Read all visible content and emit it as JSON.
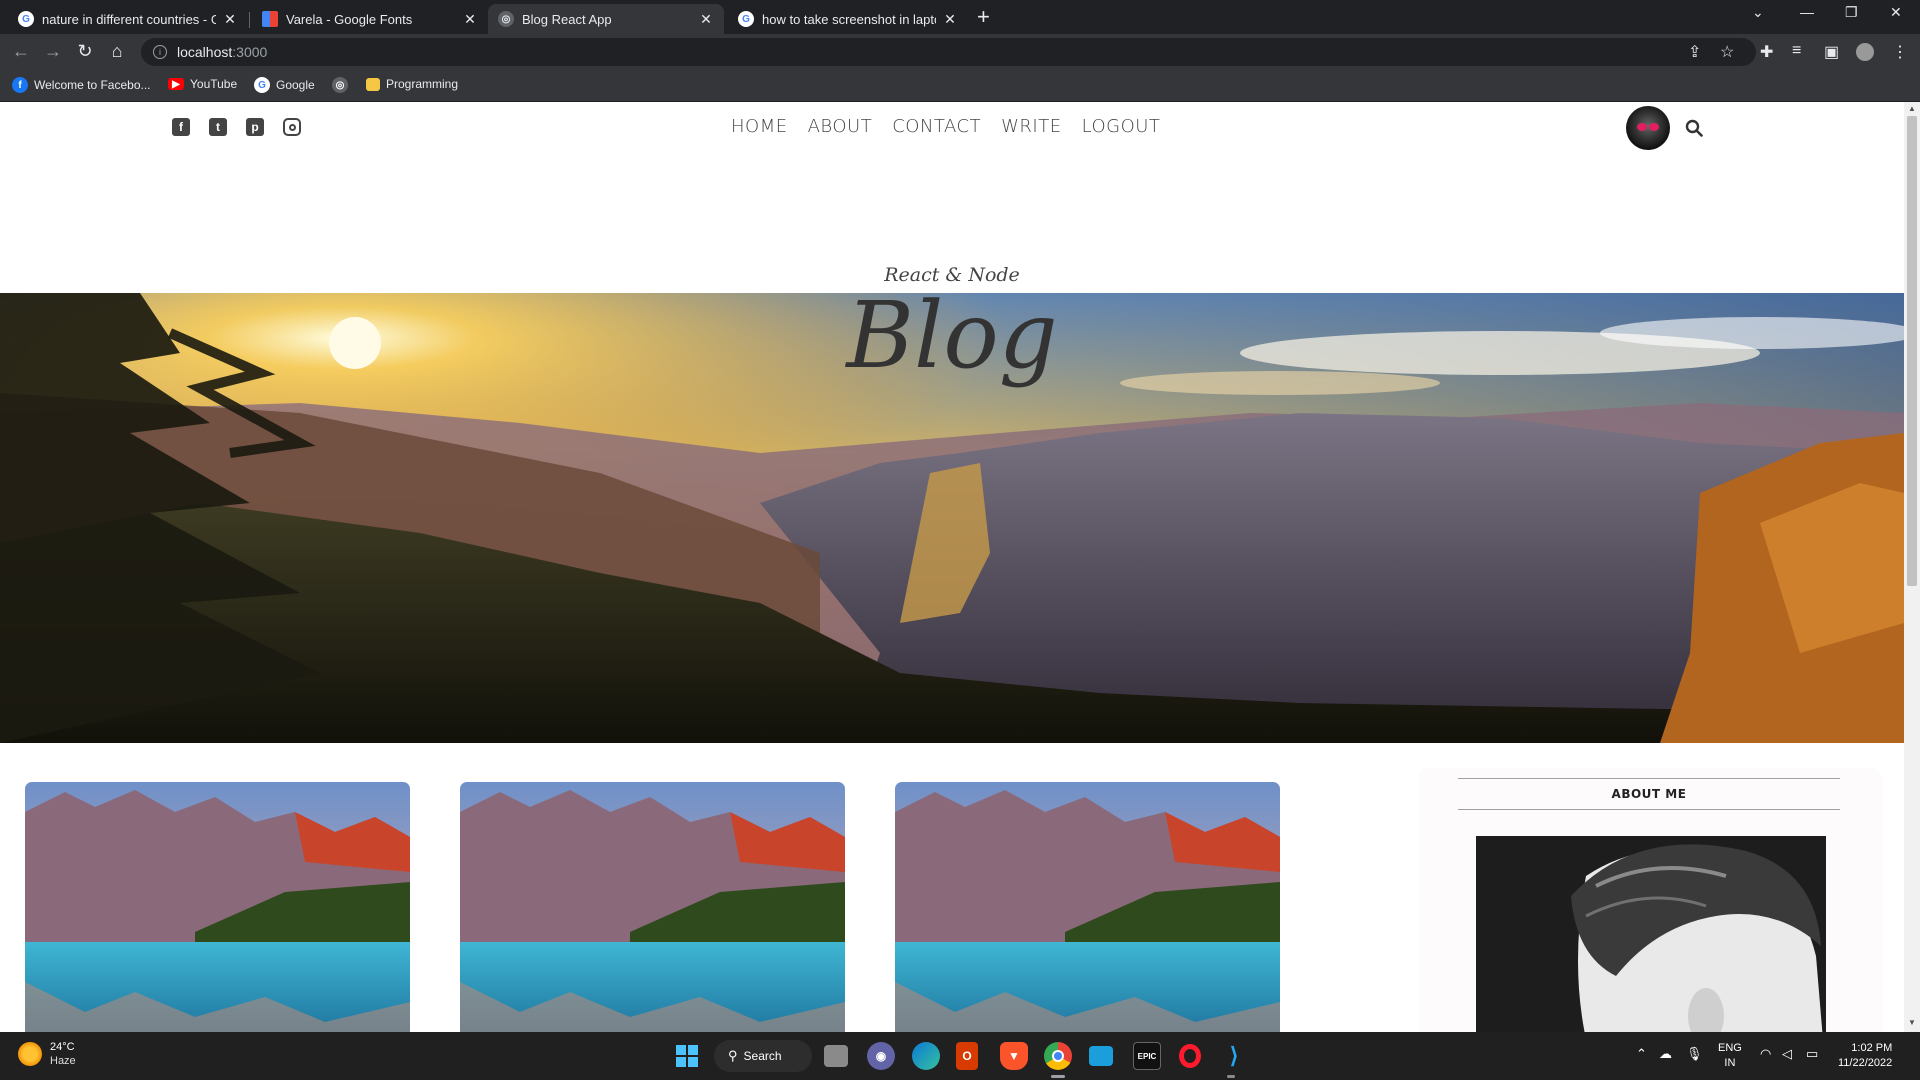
{
  "browser": {
    "tabs": [
      {
        "title": "nature in different countries - Go",
        "favicon": "google-icon",
        "active": false
      },
      {
        "title": "Varela - Google Fonts",
        "favicon": "google-fonts-icon",
        "active": false
      },
      {
        "title": "Blog React App",
        "favicon": "globe-icon",
        "active": true
      },
      {
        "title": "how to take screenshot in laptop",
        "favicon": "google-icon",
        "active": false
      }
    ],
    "address": {
      "host": "localhost",
      "port": ":3000"
    },
    "bookmarks": [
      {
        "label": "Welcome to Facebo...",
        "icon": "facebook-icon"
      },
      {
        "label": "YouTube",
        "icon": "youtube-icon"
      },
      {
        "label": "Google",
        "icon": "google-icon"
      },
      {
        "label": "",
        "icon": "globe-icon"
      },
      {
        "label": "Programming",
        "icon": "folder-icon"
      }
    ]
  },
  "site": {
    "social": [
      "facebook-icon",
      "twitter-icon",
      "pinterest-icon",
      "instagram-icon"
    ],
    "menu": [
      "HOME",
      "ABOUT",
      "CONTACT",
      "WRITE",
      "LOGOUT"
    ],
    "header": {
      "subtitle": "React & Node",
      "title": "Blog"
    },
    "sidebar": {
      "title": "ABOUT ME"
    }
  },
  "taskbar": {
    "weather": {
      "temp": "24°C",
      "condition": "Haze"
    },
    "search_label": "Search",
    "lang": {
      "line1": "ENG",
      "line2": "IN"
    },
    "clock": {
      "time": "1:02 PM",
      "date": "11/22/2022"
    }
  },
  "colors": {
    "chrome_dark": "#202124",
    "chrome_toolbar": "#35363a",
    "taskbar": "#202020",
    "menu_text": "#444444"
  }
}
